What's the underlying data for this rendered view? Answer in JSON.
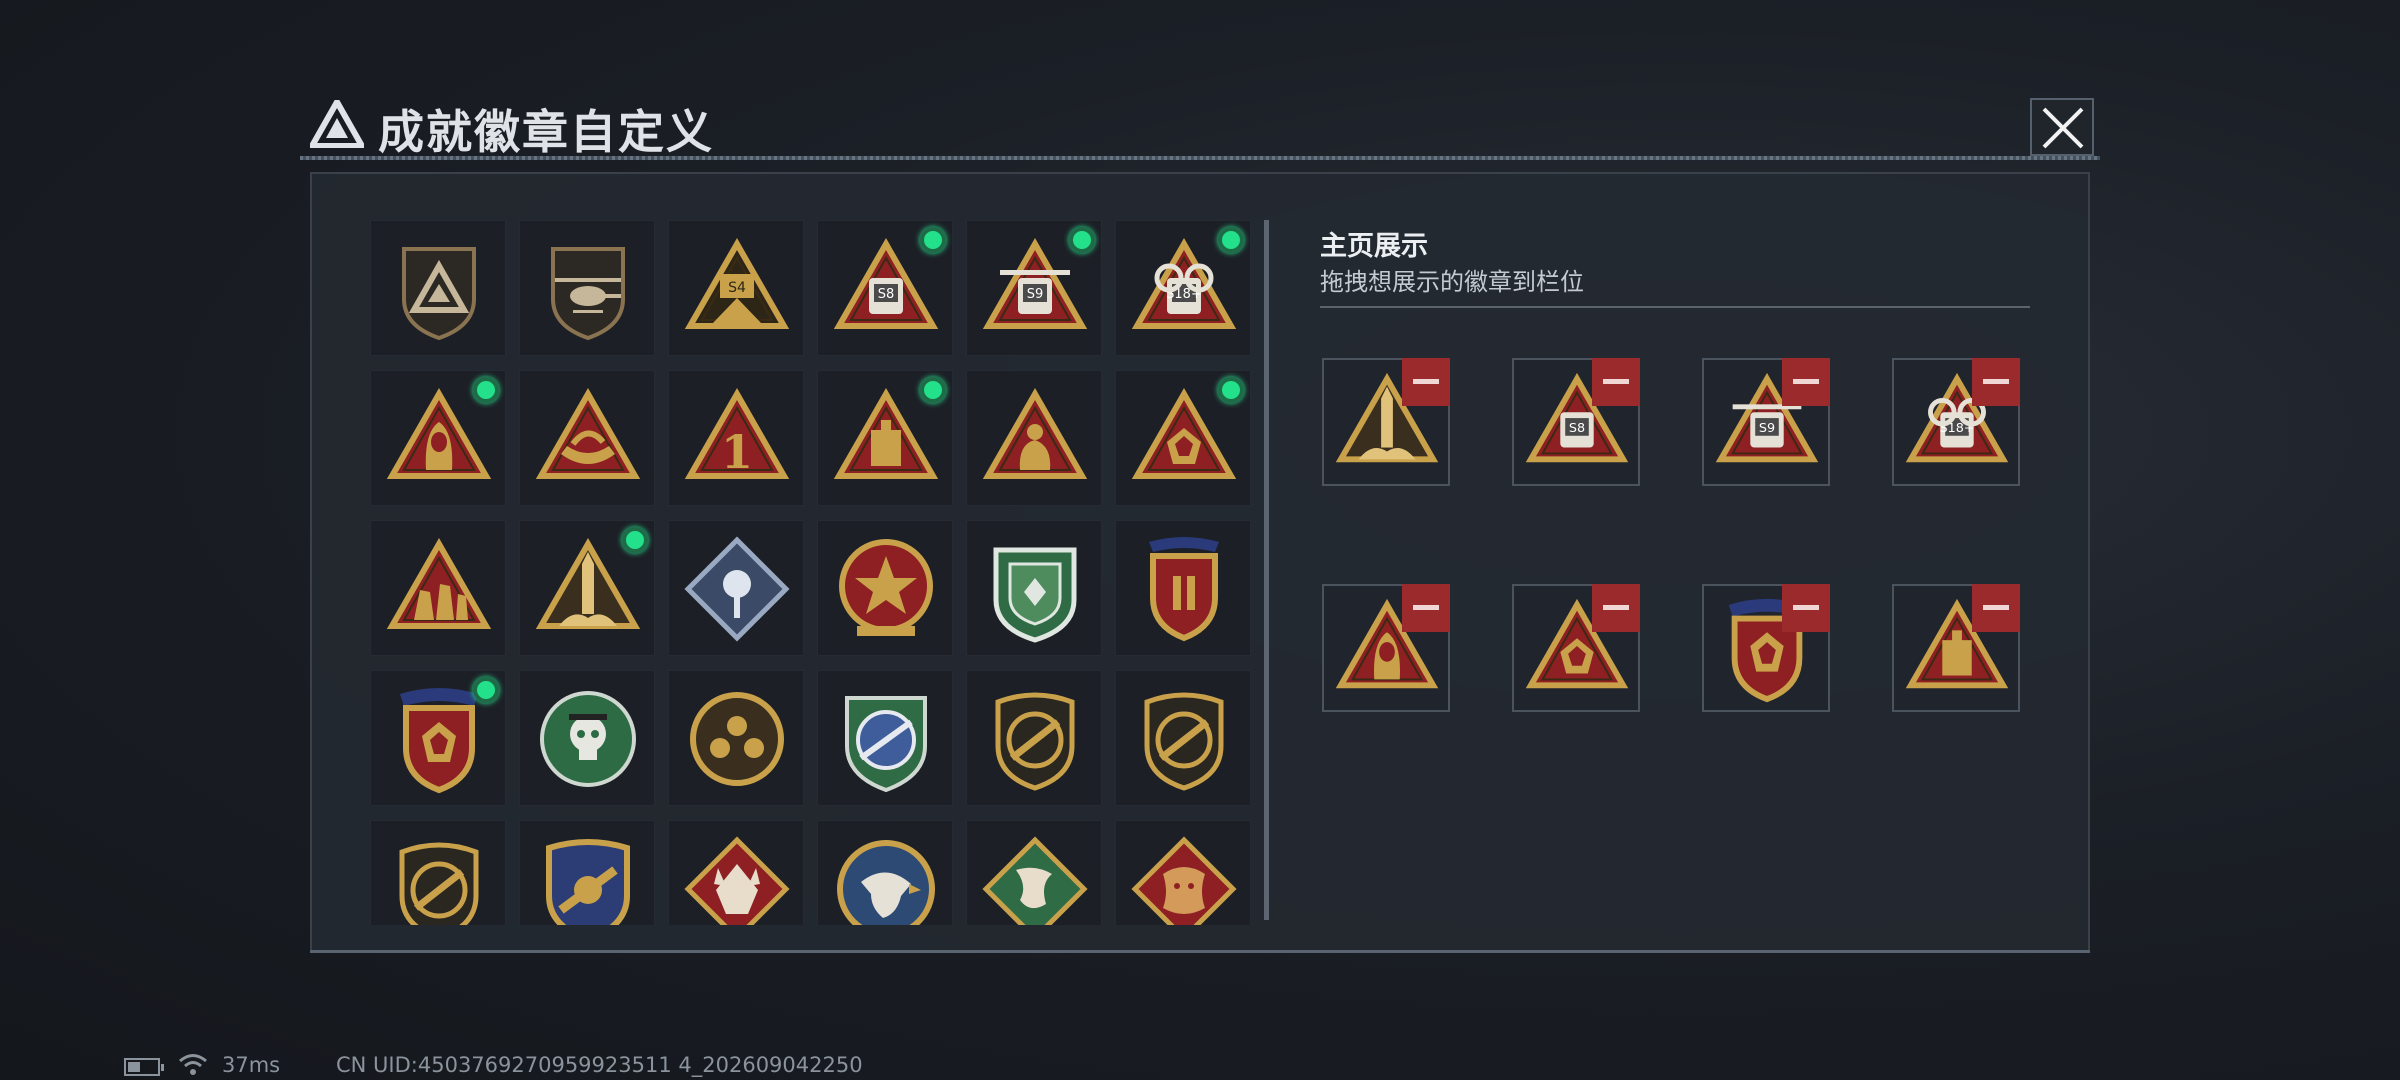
{
  "header": {
    "title": "成就徽章自定义",
    "close_label": "close"
  },
  "showcase": {
    "title": "主页展示",
    "subtitle": "拖拽想展示的徽章到栏位"
  },
  "colors": {
    "gold": "#c9a14a",
    "red": "#8e1f22",
    "green": "#23e08a",
    "remove": "#9b2a2c"
  },
  "grid": {
    "badges": [
      {
        "kind": "shield-triangle",
        "equipped": false
      },
      {
        "kind": "shield-heli",
        "equipped": false
      },
      {
        "kind": "tri-s4",
        "equipped": false
      },
      {
        "kind": "tri-s8",
        "label": "S8",
        "equipped": true
      },
      {
        "kind": "tri-s9",
        "label": "S9",
        "equipped": true
      },
      {
        "kind": "tri-s18",
        "label": "S18+",
        "equipped": true
      },
      {
        "kind": "tri-hooded",
        "equipped": true
      },
      {
        "kind": "tri-boat",
        "equipped": false
      },
      {
        "kind": "tri-one",
        "equipped": false
      },
      {
        "kind": "tri-tank",
        "equipped": true
      },
      {
        "kind": "tri-diver",
        "equipped": false
      },
      {
        "kind": "tri-gem",
        "equipped": true
      },
      {
        "kind": "tri-soldiers",
        "equipped": false
      },
      {
        "kind": "tri-rocket",
        "equipped": true
      },
      {
        "kind": "diamond-rose",
        "equipped": false
      },
      {
        "kind": "round-star",
        "equipped": false
      },
      {
        "kind": "green-shield",
        "equipped": false
      },
      {
        "kind": "laurel-shield",
        "equipped": false
      },
      {
        "kind": "laurel-red",
        "equipped": true
      },
      {
        "kind": "green-skull",
        "equipped": false
      },
      {
        "kind": "round-gold",
        "equipped": false
      },
      {
        "kind": "blue-rifle",
        "equipped": false
      },
      {
        "kind": "gun-shield",
        "equipped": false
      },
      {
        "kind": "gun-shield",
        "equipped": false
      },
      {
        "kind": "gun-shield",
        "equipped": false
      },
      {
        "kind": "blue-wing",
        "equipped": false
      },
      {
        "kind": "wolf-diamond",
        "equipped": false
      },
      {
        "kind": "eagle-round",
        "equipped": false
      },
      {
        "kind": "dragon-green",
        "equipped": false
      },
      {
        "kind": "dragon-red",
        "equipped": false
      }
    ]
  },
  "slots": [
    {
      "kind": "tri-rocket"
    },
    {
      "kind": "tri-s8",
      "label": "S8"
    },
    {
      "kind": "tri-s9",
      "label": "S9"
    },
    {
      "kind": "tri-s18",
      "label": "S18+"
    },
    {
      "kind": "tri-hooded"
    },
    {
      "kind": "tri-gem"
    },
    {
      "kind": "laurel-red"
    },
    {
      "kind": "tri-tank"
    }
  ],
  "status": {
    "ping": "37ms",
    "uid": "CN UID:4503769270959923511 4_202609042250"
  }
}
